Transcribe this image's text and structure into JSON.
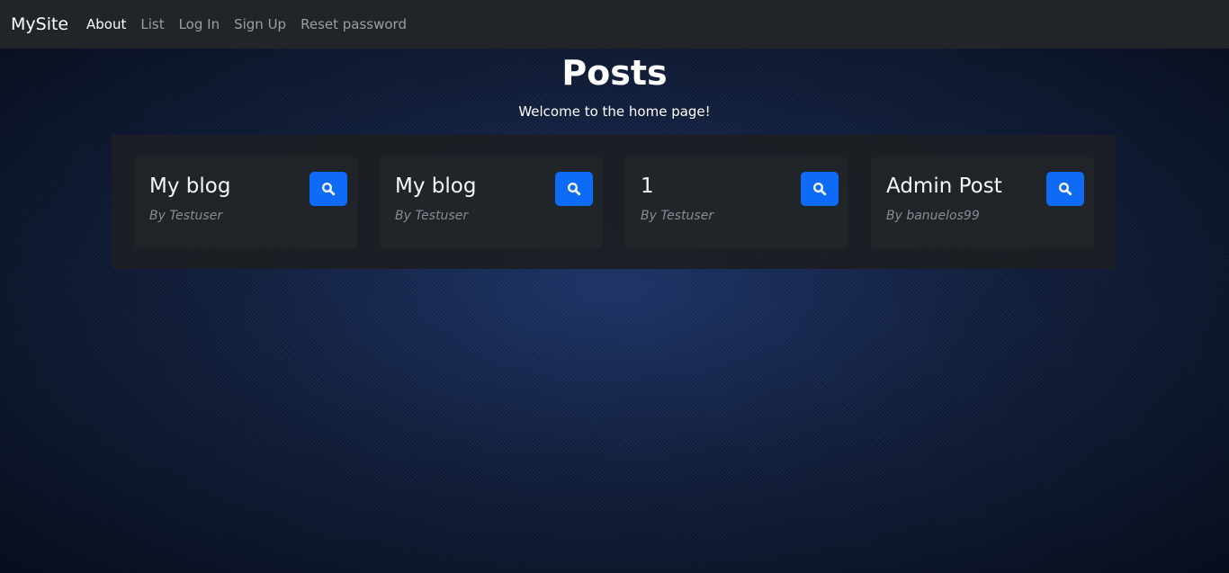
{
  "navbar": {
    "brand": "MySite",
    "links": [
      {
        "label": "About",
        "active": true
      },
      {
        "label": "List",
        "active": false
      },
      {
        "label": "Log In",
        "active": false
      },
      {
        "label": "Sign Up",
        "active": false
      },
      {
        "label": "Reset password",
        "active": false
      }
    ]
  },
  "header": {
    "title": "Posts",
    "subtitle": "Welcome to the home page!"
  },
  "posts": [
    {
      "title": "My blog",
      "author": "By Testuser",
      "button_icon": "search-icon"
    },
    {
      "title": "My blog",
      "author": "By Testuser",
      "button_icon": "search-icon"
    },
    {
      "title": "1",
      "author": "By Testuser",
      "button_icon": "search-icon"
    },
    {
      "title": "Admin Post",
      "author": "By banuelos99",
      "button_icon": "search-icon"
    }
  ],
  "colors": {
    "navbar_bg": "#212529",
    "card_bg": "#212529",
    "panel_bg": "#1c1f24",
    "accent": "#0d6efd",
    "muted_text": "#8a8f96"
  }
}
